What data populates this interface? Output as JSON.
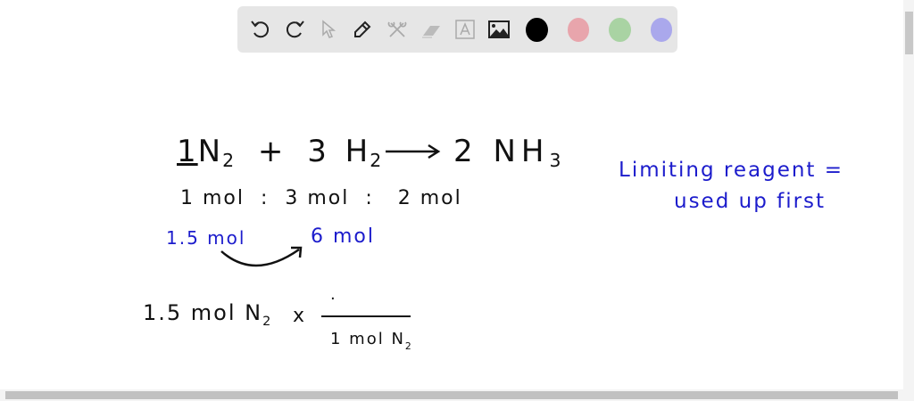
{
  "toolbar": {
    "tools": [
      "undo-icon",
      "redo-icon",
      "select-icon",
      "pen-icon",
      "tools-icon",
      "eraser-icon",
      "text-icon",
      "image-icon"
    ],
    "colors": {
      "black": "#000000",
      "pink": "#e8a5ac",
      "green": "#a9d3a3",
      "purple": "#aaa8ec"
    }
  },
  "board": {
    "eq_coef1": "1",
    "eq_n2": "N",
    "eq_sub2": "2",
    "eq_plus": "+",
    "eq_coef2": "3",
    "eq_h2": "H",
    "eq_coef3": "2",
    "eq_nh3": "NH",
    "eq_sub3": "3",
    "ratio": "1 mol  :  3 mol  :   2 mol",
    "given": "1.5 mol",
    "result": "6 mol",
    "calc_left": "1.5 mol N",
    "calc_x": "x",
    "calc_num": "·",
    "calc_den": "1 mol N",
    "note_line1": "Limiting reagent =",
    "note_line2": "used up first"
  }
}
